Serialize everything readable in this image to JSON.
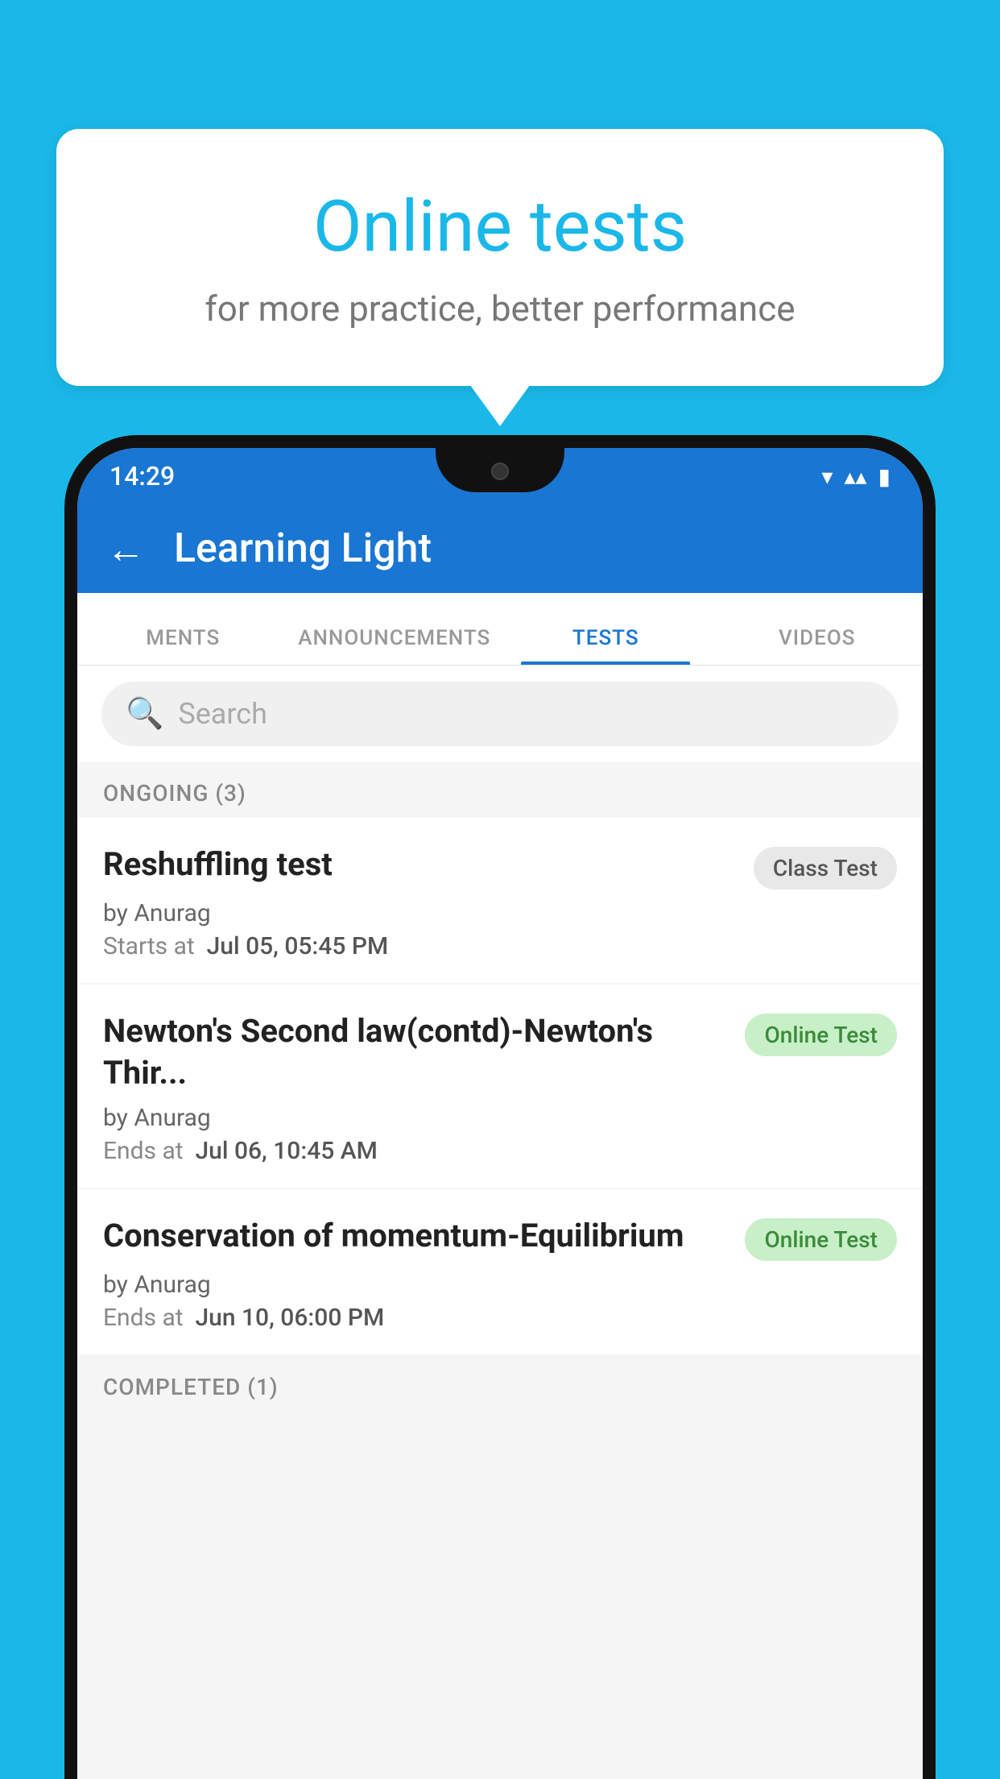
{
  "background_color": "#1ab8e8",
  "bubble": {
    "title": "Online tests",
    "subtitle": "for more practice, better performance"
  },
  "phone": {
    "status_bar": {
      "time": "14:29",
      "wifi": "▼",
      "signal": "▲",
      "battery": "▮"
    },
    "app_bar": {
      "title": "Learning Light",
      "back_label": "←"
    },
    "tabs": [
      {
        "label": "MENTS",
        "active": false
      },
      {
        "label": "ANNOUNCEMENTS",
        "active": false
      },
      {
        "label": "TESTS",
        "active": true
      },
      {
        "label": "VIDEOS",
        "active": false
      }
    ],
    "search": {
      "placeholder": "Search"
    },
    "section_ongoing": "ONGOING (3)",
    "tests": [
      {
        "name": "Reshuffling test",
        "badge": "Class Test",
        "badge_type": "class",
        "by": "by Anurag",
        "date_label": "Starts at",
        "date_value": "Jul 05, 05:45 PM"
      },
      {
        "name": "Newton's Second law(contd)-Newton's Thir...",
        "badge": "Online Test",
        "badge_type": "online",
        "by": "by Anurag",
        "date_label": "Ends at",
        "date_value": "Jul 06, 10:45 AM"
      },
      {
        "name": "Conservation of momentum-Equilibrium",
        "badge": "Online Test",
        "badge_type": "online",
        "by": "by Anurag",
        "date_label": "Ends at",
        "date_value": "Jun 10, 06:00 PM"
      }
    ],
    "section_completed": "COMPLETED (1)"
  }
}
